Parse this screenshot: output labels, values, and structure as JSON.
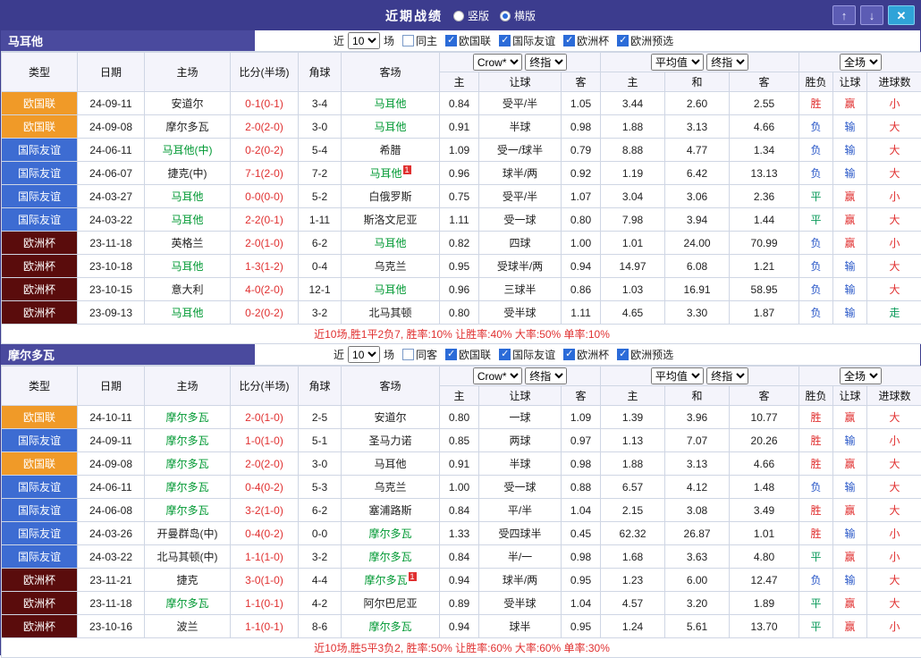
{
  "colors": {
    "topbar_bg": "#3c3c8e",
    "section_bg": "#4a4a9e",
    "league_orange": "#f09a28",
    "league_blue": "#3d6cd2",
    "league_maroon": "#5a0c0c",
    "score_red": "#e03030",
    "hot_green": "#009933",
    "win_red": "#e03030",
    "lose_blue": "#2a58c8",
    "draw_green": "#0a9a5a"
  },
  "top_bar": {
    "title": "近期战绩",
    "radios": [
      {
        "label": "竖版",
        "selected": false
      },
      {
        "label": "横版",
        "selected": true
      }
    ],
    "up_button": "↑",
    "down_button": "↓",
    "close_button": "✕"
  },
  "table_header": {
    "type": "类型",
    "date": "日期",
    "home": "主场",
    "score": "比分(半场)",
    "corner": "角球",
    "away": "客场",
    "odds1_selects": [
      "Crow*",
      "终指"
    ],
    "odds1_cols": [
      "主",
      "让球",
      "客"
    ],
    "odds2_selects": [
      "平均值",
      "终指"
    ],
    "odds2_cols": [
      "主",
      "和",
      "客"
    ],
    "scope_select": "全场",
    "result_cols": [
      "胜负",
      "让球",
      "进球数"
    ]
  },
  "sections": [
    {
      "team": "马耳他",
      "filter": {
        "near": "近",
        "count": "10",
        "games": "场",
        "same": "同主",
        "same_checked": false,
        "leagues": [
          {
            "label": "欧国联",
            "checked": true
          },
          {
            "label": "国际友谊",
            "checked": true
          },
          {
            "label": "欧洲杯",
            "checked": true
          },
          {
            "label": "欧洲预选",
            "checked": true
          }
        ]
      },
      "rows": [
        {
          "type": "欧国联",
          "date": "24-09-11",
          "home": "安道尔",
          "homeHot": false,
          "score": "0-1(0-1)",
          "corner": "3-4",
          "away": "马耳他",
          "awayHot": true,
          "o1": [
            "0.84",
            "受平/半",
            "1.05"
          ],
          "o2": [
            "3.44",
            "2.60",
            "2.55"
          ],
          "res": "胜",
          "let": "赢",
          "goal": "小"
        },
        {
          "type": "欧国联",
          "date": "24-09-08",
          "home": "摩尔多瓦",
          "homeHot": false,
          "score": "2-0(2-0)",
          "corner": "3-0",
          "away": "马耳他",
          "awayHot": true,
          "o1": [
            "0.91",
            "半球",
            "0.98"
          ],
          "o2": [
            "1.88",
            "3.13",
            "4.66"
          ],
          "res": "负",
          "let": "输",
          "goal": "大"
        },
        {
          "type": "国际友谊",
          "date": "24-06-11",
          "home": "马耳他(中)",
          "homeHot": true,
          "score": "0-2(0-2)",
          "corner": "5-4",
          "away": "希腊",
          "awayHot": false,
          "o1": [
            "1.09",
            "受一/球半",
            "0.79"
          ],
          "o2": [
            "8.88",
            "4.77",
            "1.34"
          ],
          "res": "负",
          "let": "输",
          "goal": "大"
        },
        {
          "type": "国际友谊",
          "date": "24-06-07",
          "home": "捷克(中)",
          "homeHot": false,
          "score": "7-1(2-0)",
          "corner": "7-2",
          "away": "马耳他",
          "awayHot": true,
          "awaySup": "1",
          "o1": [
            "0.96",
            "球半/两",
            "0.92"
          ],
          "o2": [
            "1.19",
            "6.42",
            "13.13"
          ],
          "res": "负",
          "let": "输",
          "goal": "大"
        },
        {
          "type": "国际友谊",
          "date": "24-03-27",
          "home": "马耳他",
          "homeHot": true,
          "score": "0-0(0-0)",
          "corner": "5-2",
          "away": "白俄罗斯",
          "awayHot": false,
          "o1": [
            "0.75",
            "受平/半",
            "1.07"
          ],
          "o2": [
            "3.04",
            "3.06",
            "2.36"
          ],
          "res": "平",
          "let": "赢",
          "goal": "小"
        },
        {
          "type": "国际友谊",
          "date": "24-03-22",
          "home": "马耳他",
          "homeHot": true,
          "score": "2-2(0-1)",
          "corner": "1-11",
          "away": "斯洛文尼亚",
          "awayHot": false,
          "o1": [
            "1.11",
            "受一球",
            "0.80"
          ],
          "o2": [
            "7.98",
            "3.94",
            "1.44"
          ],
          "res": "平",
          "let": "赢",
          "goal": "大"
        },
        {
          "type": "欧洲杯",
          "date": "23-11-18",
          "home": "英格兰",
          "homeHot": false,
          "score": "2-0(1-0)",
          "corner": "6-2",
          "away": "马耳他",
          "awayHot": true,
          "o1": [
            "0.82",
            "四球",
            "1.00"
          ],
          "o2": [
            "1.01",
            "24.00",
            "70.99"
          ],
          "res": "负",
          "let": "赢",
          "goal": "小"
        },
        {
          "type": "欧洲杯",
          "date": "23-10-18",
          "home": "马耳他",
          "homeHot": true,
          "score": "1-3(1-2)",
          "corner": "0-4",
          "away": "乌克兰",
          "awayHot": false,
          "o1": [
            "0.95",
            "受球半/两",
            "0.94"
          ],
          "o2": [
            "14.97",
            "6.08",
            "1.21"
          ],
          "res": "负",
          "let": "输",
          "goal": "大"
        },
        {
          "type": "欧洲杯",
          "date": "23-10-15",
          "home": "意大利",
          "homeHot": false,
          "score": "4-0(2-0)",
          "corner": "12-1",
          "away": "马耳他",
          "awayHot": true,
          "o1": [
            "0.96",
            "三球半",
            "0.86"
          ],
          "o2": [
            "1.03",
            "16.91",
            "58.95"
          ],
          "res": "负",
          "let": "输",
          "goal": "大"
        },
        {
          "type": "欧洲杯",
          "date": "23-09-13",
          "home": "马耳他",
          "homeHot": true,
          "score": "0-2(0-2)",
          "corner": "3-2",
          "away": "北马其顿",
          "awayHot": false,
          "o1": [
            "0.80",
            "受半球",
            "1.11"
          ],
          "o2": [
            "4.65",
            "3.30",
            "1.87"
          ],
          "res": "负",
          "let": "输",
          "goal": "走"
        }
      ],
      "summary": "近10场,胜1平2负7, 胜率:10% 让胜率:40% 大率:50% 单率:10%"
    },
    {
      "team": "摩尔多瓦",
      "filter": {
        "near": "近",
        "count": "10",
        "games": "场",
        "same": "同客",
        "same_checked": false,
        "leagues": [
          {
            "label": "欧国联",
            "checked": true
          },
          {
            "label": "国际友谊",
            "checked": true
          },
          {
            "label": "欧洲杯",
            "checked": true
          },
          {
            "label": "欧洲预选",
            "checked": true
          }
        ]
      },
      "rows": [
        {
          "type": "欧国联",
          "date": "24-10-11",
          "home": "摩尔多瓦",
          "homeHot": true,
          "score": "2-0(1-0)",
          "corner": "2-5",
          "away": "安道尔",
          "awayHot": false,
          "o1": [
            "0.80",
            "一球",
            "1.09"
          ],
          "o2": [
            "1.39",
            "3.96",
            "10.77"
          ],
          "res": "胜",
          "let": "赢",
          "goal": "大"
        },
        {
          "type": "国际友谊",
          "date": "24-09-11",
          "home": "摩尔多瓦",
          "homeHot": true,
          "score": "1-0(1-0)",
          "corner": "5-1",
          "away": "圣马力诺",
          "awayHot": false,
          "o1": [
            "0.85",
            "两球",
            "0.97"
          ],
          "o2": [
            "1.13",
            "7.07",
            "20.26"
          ],
          "res": "胜",
          "let": "输",
          "goal": "小"
        },
        {
          "type": "欧国联",
          "date": "24-09-08",
          "home": "摩尔多瓦",
          "homeHot": true,
          "score": "2-0(2-0)",
          "corner": "3-0",
          "away": "马耳他",
          "awayHot": false,
          "o1": [
            "0.91",
            "半球",
            "0.98"
          ],
          "o2": [
            "1.88",
            "3.13",
            "4.66"
          ],
          "res": "胜",
          "let": "赢",
          "goal": "大"
        },
        {
          "type": "国际友谊",
          "date": "24-06-11",
          "home": "摩尔多瓦",
          "homeHot": true,
          "score": "0-4(0-2)",
          "corner": "5-3",
          "away": "乌克兰",
          "awayHot": false,
          "o1": [
            "1.00",
            "受一球",
            "0.88"
          ],
          "o2": [
            "6.57",
            "4.12",
            "1.48"
          ],
          "res": "负",
          "let": "输",
          "goal": "大"
        },
        {
          "type": "国际友谊",
          "date": "24-06-08",
          "home": "摩尔多瓦",
          "homeHot": true,
          "score": "3-2(1-0)",
          "corner": "6-2",
          "away": "塞浦路斯",
          "awayHot": false,
          "o1": [
            "0.84",
            "平/半",
            "1.04"
          ],
          "o2": [
            "2.15",
            "3.08",
            "3.49"
          ],
          "res": "胜",
          "let": "赢",
          "goal": "大"
        },
        {
          "type": "国际友谊",
          "date": "24-03-26",
          "home": "开曼群岛(中)",
          "homeHot": false,
          "score": "0-4(0-2)",
          "corner": "0-0",
          "away": "摩尔多瓦",
          "awayHot": true,
          "o1": [
            "1.33",
            "受四球半",
            "0.45"
          ],
          "o2": [
            "62.32",
            "26.87",
            "1.01"
          ],
          "res": "胜",
          "let": "输",
          "goal": "小"
        },
        {
          "type": "国际友谊",
          "date": "24-03-22",
          "home": "北马其顿(中)",
          "homeHot": false,
          "score": "1-1(1-0)",
          "corner": "3-2",
          "away": "摩尔多瓦",
          "awayHot": true,
          "o1": [
            "0.84",
            "半/一",
            "0.98"
          ],
          "o2": [
            "1.68",
            "3.63",
            "4.80"
          ],
          "res": "平",
          "let": "赢",
          "goal": "小"
        },
        {
          "type": "欧洲杯",
          "date": "23-11-21",
          "home": "捷克",
          "homeHot": false,
          "score": "3-0(1-0)",
          "corner": "4-4",
          "away": "摩尔多瓦",
          "awayHot": true,
          "awaySup": "1",
          "o1": [
            "0.94",
            "球半/两",
            "0.95"
          ],
          "o2": [
            "1.23",
            "6.00",
            "12.47"
          ],
          "res": "负",
          "let": "输",
          "goal": "大"
        },
        {
          "type": "欧洲杯",
          "date": "23-11-18",
          "home": "摩尔多瓦",
          "homeHot": true,
          "score": "1-1(0-1)",
          "corner": "4-2",
          "away": "阿尔巴尼亚",
          "awayHot": false,
          "o1": [
            "0.89",
            "受半球",
            "1.04"
          ],
          "o2": [
            "4.57",
            "3.20",
            "1.89"
          ],
          "res": "平",
          "let": "赢",
          "goal": "大"
        },
        {
          "type": "欧洲杯",
          "date": "23-10-16",
          "home": "波兰",
          "homeHot": false,
          "score": "1-1(0-1)",
          "corner": "8-6",
          "away": "摩尔多瓦",
          "awayHot": true,
          "o1": [
            "0.94",
            "球半",
            "0.95"
          ],
          "o2": [
            "1.24",
            "5.61",
            "13.70"
          ],
          "res": "平",
          "let": "赢",
          "goal": "小"
        }
      ],
      "summary": "近10场,胜5平3负2, 胜率:50% 让胜率:60% 大率:60% 单率:30%"
    }
  ]
}
